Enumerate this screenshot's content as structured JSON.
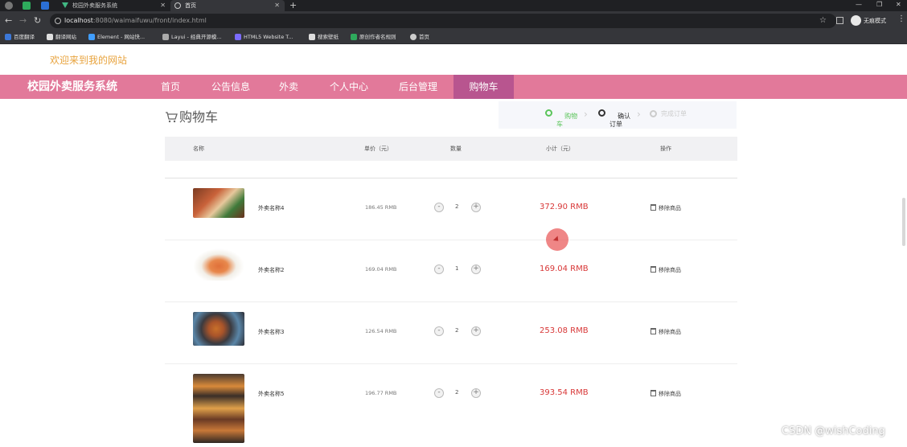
{
  "browser": {
    "tabs": [
      {
        "label": "校园外卖服务系统",
        "active": false
      },
      {
        "label": "首页",
        "active": true
      }
    ],
    "url_host": "localhost",
    "url_rest": ":8080/waimaifuwu/front/index.html",
    "incognito_label": "无痕模式",
    "bookmarks": [
      "百度翻译",
      "翻译网站",
      "Element - 网站快...",
      "Layui - 经典开源模...",
      "HTML5 Website T...",
      "搜索壁纸",
      "原创作者名规则",
      "首页"
    ]
  },
  "page": {
    "welcome": "欢迎来到我的网站",
    "brand": "校园外卖服务系统",
    "nav": [
      "首页",
      "公告信息",
      "外卖",
      "个人中心",
      "后台管理",
      "购物车"
    ],
    "active_nav": "购物车",
    "cart_title": "购物车",
    "steps": [
      {
        "label": "购物\n车",
        "state": "done"
      },
      {
        "label": "确认\n订单",
        "state": "current"
      },
      {
        "label": "完成订单",
        "state": "todo"
      }
    ],
    "table_headers": {
      "name": "名称",
      "unit_price": "单价（元）",
      "quantity": "数量",
      "subtotal": "小计（元）",
      "action": "操作"
    },
    "items": [
      {
        "name": "外卖名称4",
        "price": "186.45 RMB",
        "qty": "2",
        "subtotal": "372.90 RMB",
        "remove": "移除商品"
      },
      {
        "name": "外卖名称2",
        "price": "169.04 RMB",
        "qty": "1",
        "subtotal": "169.04 RMB",
        "remove": "移除商品"
      },
      {
        "name": "外卖名称3",
        "price": "126.54 RMB",
        "qty": "2",
        "subtotal": "253.08 RMB",
        "remove": "移除商品"
      },
      {
        "name": "外卖名称5",
        "price": "196.77 RMB",
        "qty": "2",
        "subtotal": "393.54 RMB",
        "remove": "移除商品"
      }
    ],
    "qty_minus": "-",
    "qty_plus": "+"
  },
  "watermark": "CSDN @wishCoding",
  "colors": {
    "nav_bg": "#e2799a",
    "nav_active": "#b8558f",
    "welcome": "#e8a33d",
    "price_red": "#d83737",
    "step_done": "#5ac45a"
  }
}
